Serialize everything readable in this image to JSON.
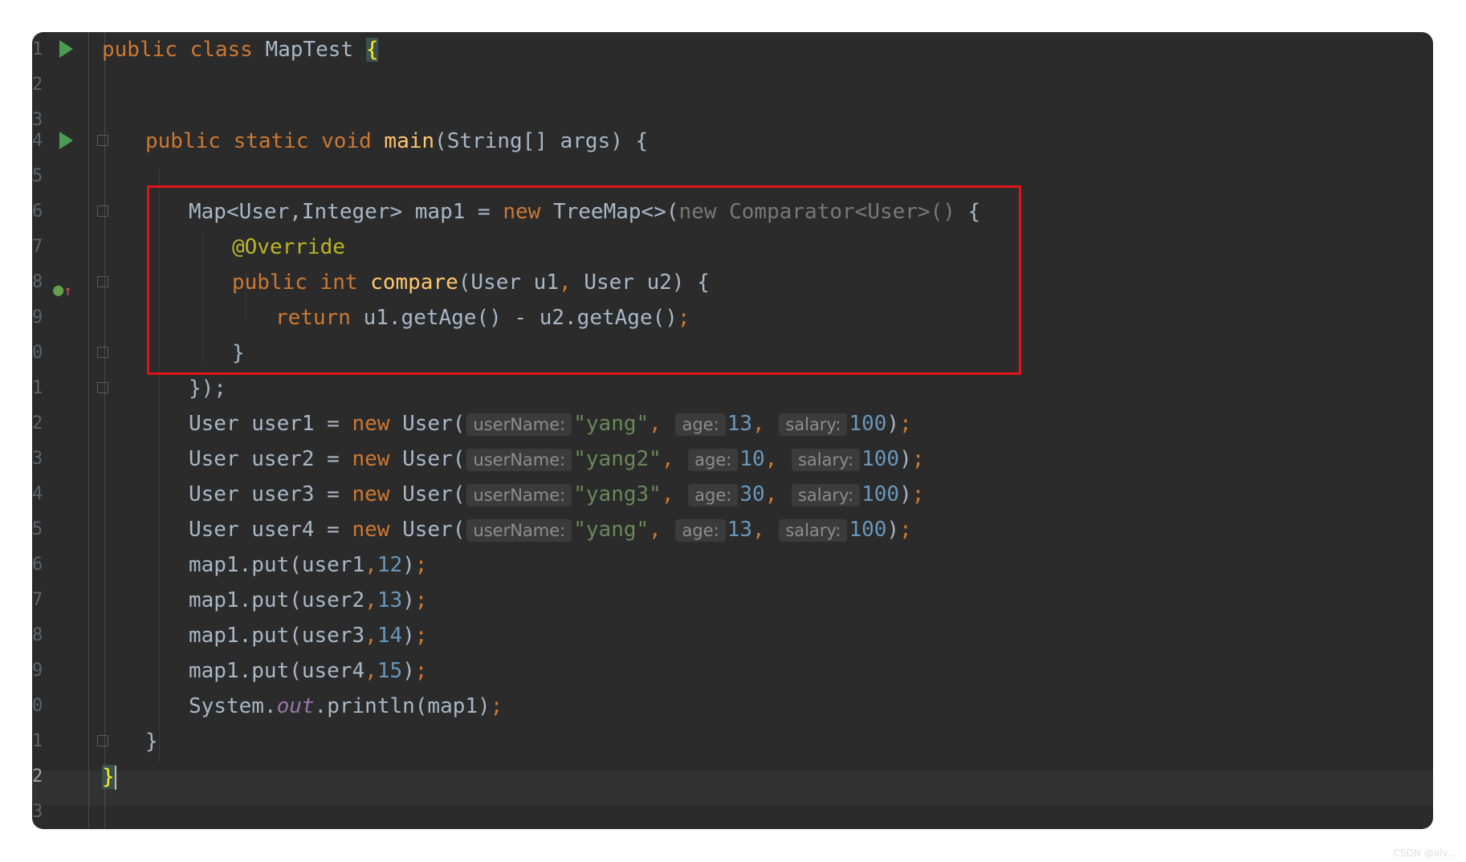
{
  "editor": {
    "lines": [
      {
        "no": "1",
        "marker": "run"
      },
      {
        "no": "2"
      },
      {
        "no": "3"
      },
      {
        "no": "4",
        "marker": "run",
        "fold": true
      },
      {
        "no": "5"
      },
      {
        "no": "6",
        "fold": true
      },
      {
        "no": "7"
      },
      {
        "no": "8",
        "marker": "override",
        "fold": true
      },
      {
        "no": "9"
      },
      {
        "no": "0",
        "fold": true
      },
      {
        "no": "1",
        "fold": true
      },
      {
        "no": "2"
      },
      {
        "no": "3"
      },
      {
        "no": "4"
      },
      {
        "no": "5"
      },
      {
        "no": "6"
      },
      {
        "no": "7"
      },
      {
        "no": "8"
      },
      {
        "no": "9"
      },
      {
        "no": "0"
      },
      {
        "no": "1",
        "fold": true
      },
      {
        "no": "2",
        "current": true
      },
      {
        "no": "3"
      }
    ],
    "code": {
      "l1": {
        "kw": "public class ",
        "name": "MapTest ",
        "brace": "{"
      },
      "l4": {
        "kw": "public static void ",
        "fn": "main",
        "rest": "(String[] args) {"
      },
      "l6": {
        "a": "Map<User,Integer> map1 = ",
        "kw": "new ",
        "b": "TreeMap<>(",
        "dim": "new Comparator<User>()",
        "c": " {"
      },
      "l7": {
        "ann": "@Override"
      },
      "l8": {
        "kw": "public int ",
        "fn": "compare",
        "rest": "(User u1",
        "comma": ", ",
        "rest2": "User u2) {"
      },
      "l9": {
        "kw": "return ",
        "rest": "u1.getAge() - u2.getAge()",
        "semi": ";"
      },
      "l10": {
        "text": "}"
      },
      "l11": {
        "text": "});"
      },
      "users": [
        {
          "lhs": "User user1 = ",
          "name": "\"yang\"",
          "age": "13",
          "salary": "100"
        },
        {
          "lhs": "User user2 = ",
          "name": "\"yang2\"",
          "age": "10",
          "salary": "100"
        },
        {
          "lhs": "User user3 = ",
          "name": "\"yang3\"",
          "age": "30",
          "salary": "100"
        },
        {
          "lhs": "User user4 = ",
          "name": "\"yang\"",
          "age": "13",
          "salary": "100"
        }
      ],
      "new_kw": "new ",
      "ctor": "User(",
      "hint_username": "userName:",
      "hint_age": "age:",
      "hint_salary": "salary:",
      "puts": [
        {
          "call": "map1.put(user1",
          "val": "12"
        },
        {
          "call": "map1.put(user2",
          "val": "13"
        },
        {
          "call": "map1.put(user3",
          "val": "14"
        },
        {
          "call": "map1.put(user4",
          "val": "15"
        }
      ],
      "println": {
        "a": "System.",
        "field": "out",
        "b": ".println(map1)",
        "semi": ";"
      },
      "close_main": "}",
      "close_class": "}"
    }
  },
  "watermark": "CSDN @alv..."
}
